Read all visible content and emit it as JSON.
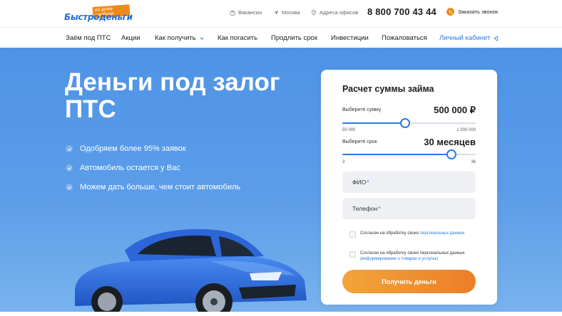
{
  "brand": {
    "logo_text": "Быстроденьги",
    "logo_badge": "из дома удобнее"
  },
  "topbar": {
    "vacancies": "Вакансии",
    "city": "Москва",
    "offices": "Адреса офисов",
    "phone": "8 800 700 43 44",
    "callback": "Заказать звонок"
  },
  "nav": {
    "items": [
      "Заём под ПТС",
      "Акции",
      "Как получить",
      "Как погасить",
      "Продлить срок",
      "Инвестиции",
      "Пожаловаться"
    ],
    "cabinet": "Личный кабинет"
  },
  "hero": {
    "title": "Деньги под залог ПТС",
    "benefits": [
      "Одобряем более 95% заявок",
      "Автомобиль остается у Вас",
      "Можем дать больше, чем стоит автомобиль"
    ]
  },
  "calculator": {
    "title": "Расчет суммы займа",
    "amount": {
      "label": "Выберите сумму",
      "value": "500 000 ₽",
      "min": "50 000",
      "max": "1 000 000",
      "fraction": 0.47
    },
    "term": {
      "label": "Выберите срок",
      "value": "30 месяцев",
      "min": "3",
      "max": "36",
      "fraction": 0.82
    },
    "fio_placeholder": "ФИО",
    "phone_placeholder": "Телефон",
    "required_mark": "*",
    "consent1_text": "Согласен на обработку своих ",
    "consent1_link": "персональных данных",
    "consent2_text": "Согласен на обработку своих персональных данных ",
    "consent2_link": "(информирование о товарах и услугах)",
    "submit": "Получить деньги"
  },
  "colors": {
    "accent": "#2a7ae0",
    "hero_bg": "#5b9de8",
    "cta": "#ec7e28",
    "car": "#2f6fe0"
  }
}
